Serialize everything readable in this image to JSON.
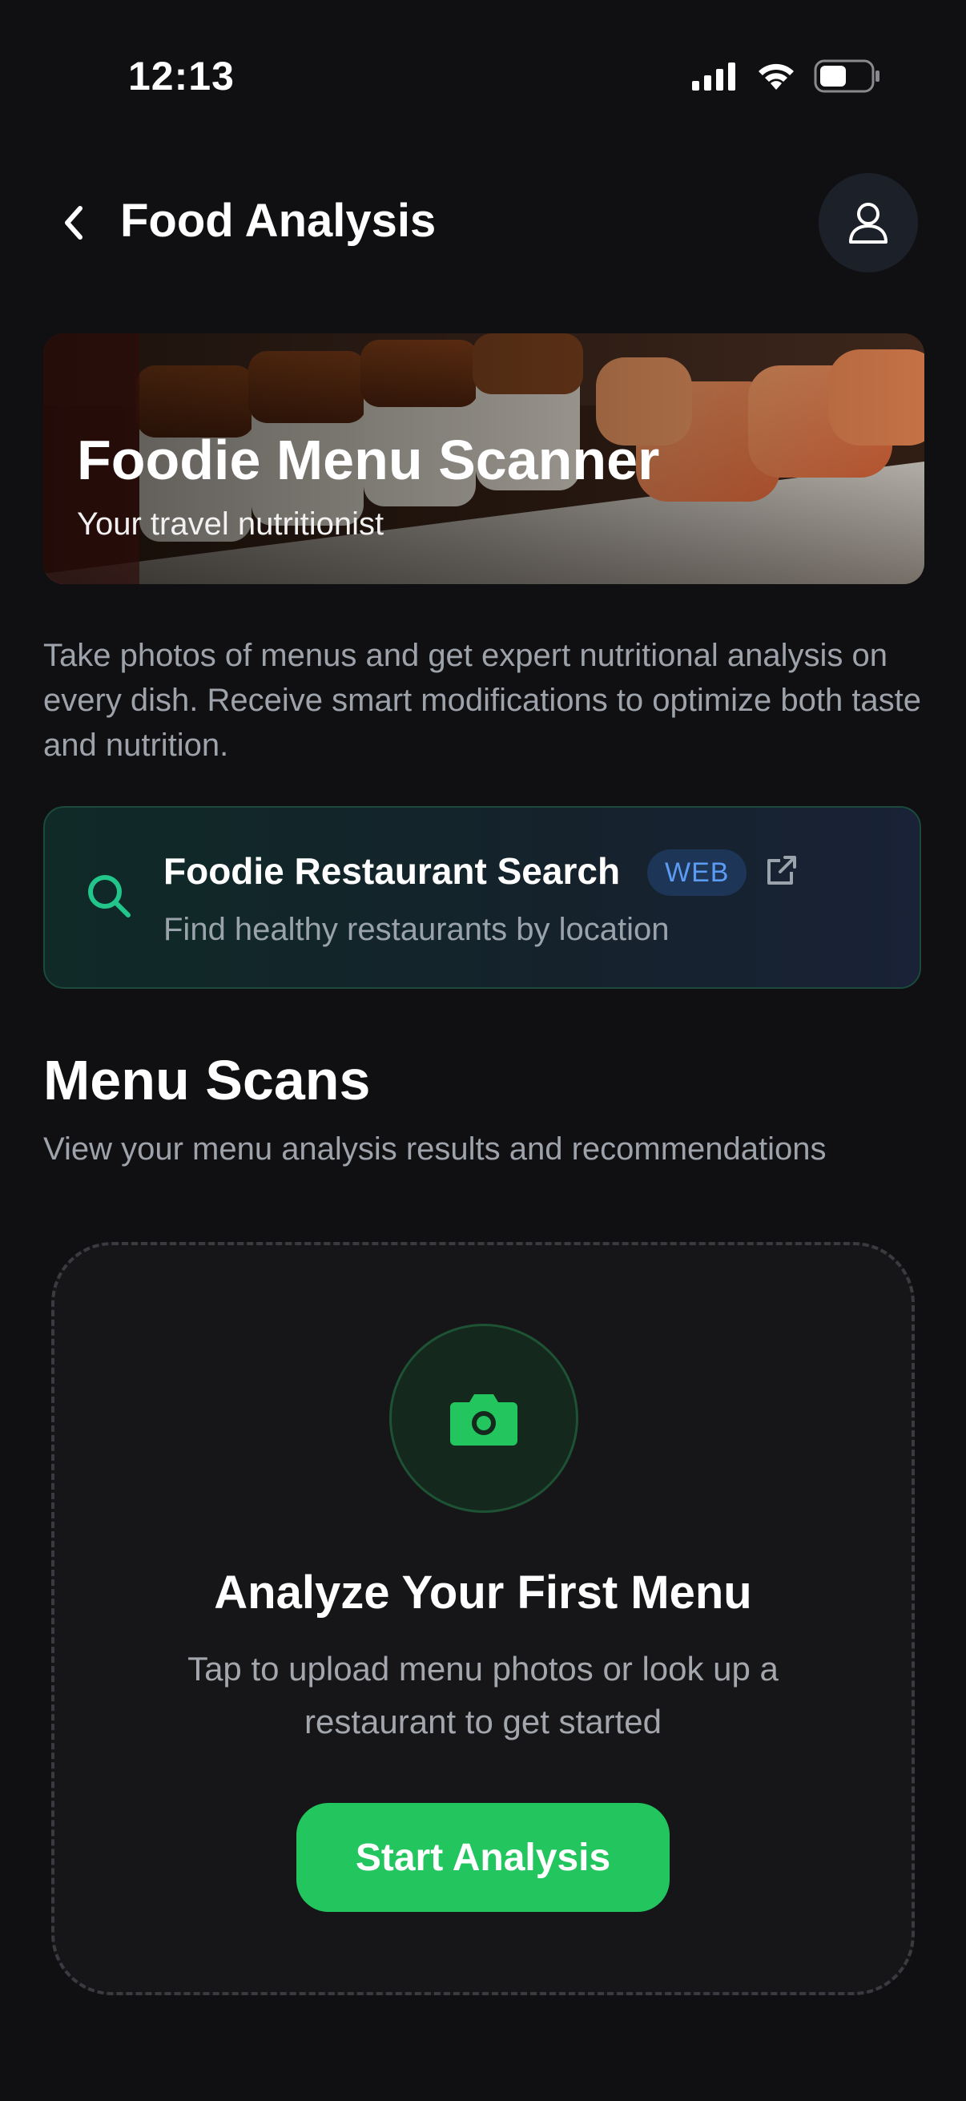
{
  "status_bar": {
    "time": "12:13",
    "icons": [
      "signal-icon",
      "wifi-icon",
      "battery-icon"
    ]
  },
  "header": {
    "title": "Food Analysis",
    "back_icon": "chevron-left-icon",
    "profile_icon": "user-icon"
  },
  "hero": {
    "title": "Foodie Menu Scanner",
    "subtitle": "Your travel nutritionist"
  },
  "description": "Take photos of menus and get expert nutritional analysis on every dish. Receive smart modifications to optimize both taste and nutrition.",
  "restaurant_search": {
    "title": "Foodie Restaurant Search",
    "badge": "WEB",
    "subtitle": "Find healthy restaurants by location",
    "icon": "search-icon",
    "link_icon": "external-link-icon"
  },
  "menu_scans": {
    "title": "Menu Scans",
    "subtitle": "View your menu analysis results and recommendations",
    "empty_state": {
      "icon": "camera-icon",
      "title": "Analyze Your First Menu",
      "subtitle": "Tap to upload menu photos or look up a restaurant to get started",
      "button_label": "Start Analysis"
    }
  },
  "colors": {
    "background": "#101012",
    "accent_green": "#22c55e",
    "badge_blue": "#5b9bf3",
    "muted_text": "#9ea3ab"
  }
}
